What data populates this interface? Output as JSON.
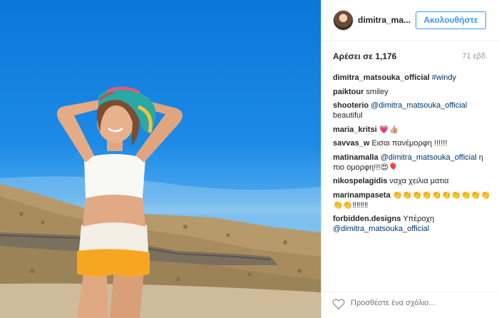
{
  "post": {
    "username": "dimitra_ma...",
    "follow_label": "Ακολουθήστε",
    "likes_text": "Αρέσει σε 1,176",
    "age_text": "71 εβδ.",
    "add_comment_placeholder": "Προσθέστε ένα σχόλιο..."
  },
  "comments": [
    {
      "user": "dimitra_matsouka_official",
      "text": "",
      "mention": "#windy"
    },
    {
      "user": "paiktour",
      "text": "smiley",
      "mention": ""
    },
    {
      "user": "shooterio",
      "text": "beautiful",
      "mention": "@dimitra_matsouka_official"
    },
    {
      "user": "maria_kritsi",
      "text": "💗👍🏼",
      "mention": ""
    },
    {
      "user": "savvas_w",
      "text": "Εισαι πανέμορφη !!!!!!",
      "mention": ""
    },
    {
      "user": "matinamalla",
      "text": "η πιο ομορφη!!!😍🎈",
      "mention": "@dimitra_matsouka_official"
    },
    {
      "user": "nikospelagidis",
      "text": "ναχα χειλια ματια",
      "mention": ""
    },
    {
      "user": "marinampaseta",
      "text": "👏👏👏👏👏👏👏👏👏👏👏👏‼‼‼‼",
      "mention": ""
    },
    {
      "user": "forbidden.designs",
      "text": "Υπέροχη",
      "mention": "@dimitra_matsouka_official"
    }
  ],
  "icons": {
    "like": "heart-outline-icon",
    "avatar": "profile-avatar"
  },
  "colors": {
    "accent": "#3897f0",
    "mention": "#003569",
    "muted": "#999999",
    "sky": "#1c8ae6"
  }
}
